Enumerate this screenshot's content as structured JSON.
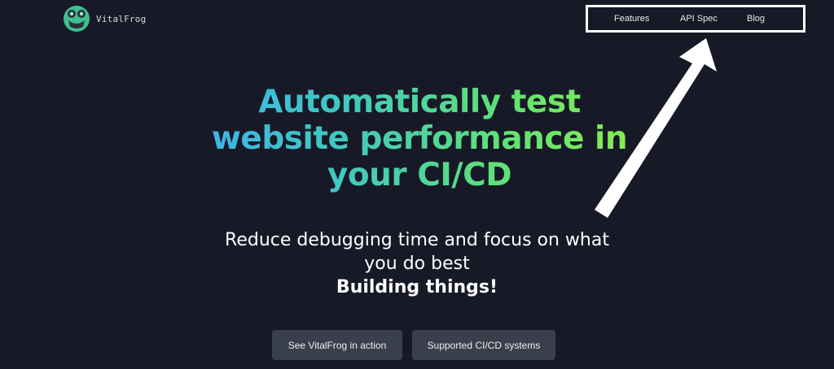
{
  "brand": {
    "name": "VitalFrog",
    "logo_icon": "frog-logo-icon"
  },
  "nav": {
    "items": [
      {
        "label": "Features"
      },
      {
        "label": "API Spec"
      },
      {
        "label": "Blog"
      }
    ]
  },
  "hero": {
    "headline_lines": [
      "Automatically test",
      "website performance in",
      "your CI/CD"
    ],
    "subline_lines": [
      "Reduce debugging time and focus on what",
      "you do best"
    ],
    "subline_bold": "Building things!"
  },
  "actions": {
    "primary_label": "See VitalFrog in action",
    "secondary_label": "Supported CI/CD systems"
  },
  "annotation": {
    "arrow_icon": "white-arrow-icon"
  },
  "colors": {
    "background": "#171a26",
    "gradient_start": "#3eaff2",
    "gradient_mid": "#40c9be",
    "gradient_end": "#8ff046",
    "button_bg": "#3a404b",
    "text": "#ffffff"
  }
}
